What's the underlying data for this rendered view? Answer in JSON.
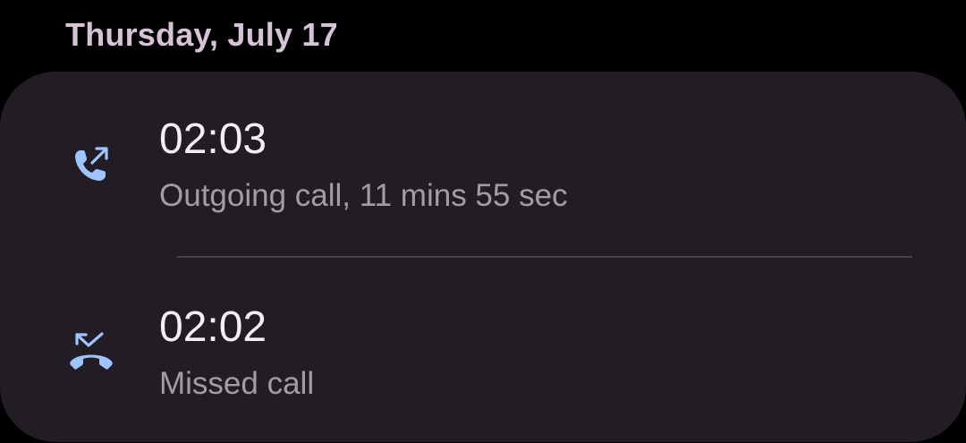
{
  "date_header": "Thursday, July 17",
  "colors": {
    "background": "#000000",
    "card": "#221d24",
    "date_text": "#d7c3d6",
    "icon": "#9ec5ff",
    "primary_text": "#f4eff4",
    "secondary_text": "#a39da3",
    "divider": "#48424a"
  },
  "calls": [
    {
      "icon": "outgoing-call-icon",
      "time": "02:03",
      "detail": "Outgoing call, 11 mins 55 sec"
    },
    {
      "icon": "missed-call-icon",
      "time": "02:02",
      "detail": "Missed call"
    }
  ]
}
